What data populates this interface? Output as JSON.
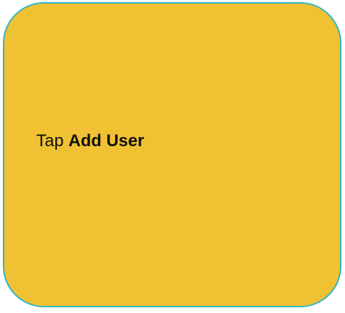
{
  "card": {
    "prefix": "Tap ",
    "action_label": "Add User",
    "fill_color": "#f0c132",
    "border_color": "#2fb5c8"
  }
}
